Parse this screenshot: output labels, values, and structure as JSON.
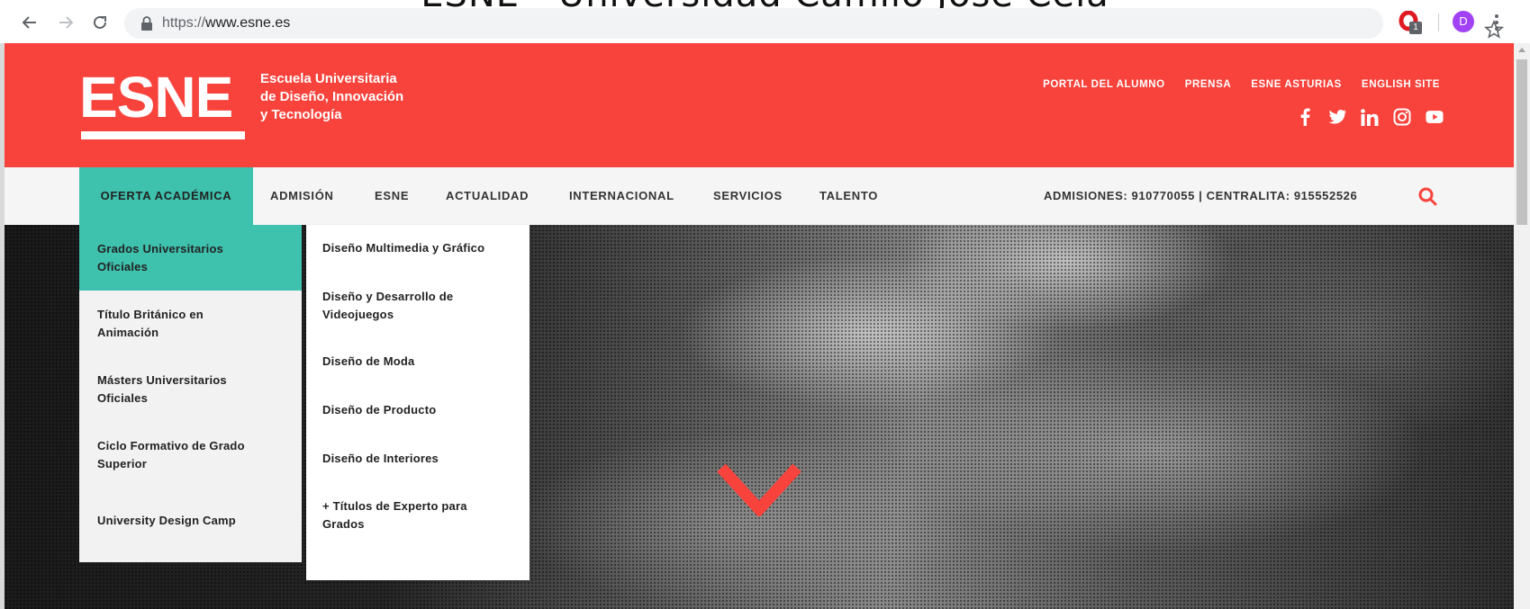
{
  "browser": {
    "window_title": "ESNE - Universidad Camilo José Cela",
    "url_scheme": "https://",
    "url_host": "www.esne.es",
    "extension_badge": "1",
    "profile_initial": "D"
  },
  "header": {
    "logo_text": "ESNE",
    "tagline": [
      "Escuela Universitaria",
      "de Diseño, Innovación",
      "y Tecnología"
    ],
    "top_links": [
      "PORTAL DEL ALUMNO",
      "PRENSA",
      "ESNE ASTURIAS",
      "ENGLISH SITE"
    ],
    "social": [
      "facebook-icon",
      "twitter-icon",
      "linkedin-icon",
      "instagram-icon",
      "youtube-icon"
    ]
  },
  "nav": {
    "items": [
      "OFERTA ACADÉMICA",
      "ADMISIÓN",
      "ESNE",
      "ACTUALIDAD",
      "INTERNACIONAL",
      "SERVICIOS",
      "TALENTO"
    ],
    "contact": "ADMISIONES: 910770055 | CENTRALITA: 915552526"
  },
  "mega_menu": {
    "categories": [
      [
        "Grados Universitarios",
        "Oficiales"
      ],
      [
        "Título Británico en",
        "Animación"
      ],
      [
        "Másters Universitarios",
        "Oficiales"
      ],
      [
        "Ciclo Formativo de Grado",
        "Superior"
      ],
      [
        "University Design Camp"
      ]
    ],
    "active_category": 0,
    "subitems": [
      [
        "Diseño Multimedia y Gráfico"
      ],
      [
        "Diseño y Desarrollo de",
        "Videojuegos"
      ],
      [
        "Diseño de Moda"
      ],
      [
        "Diseño de Producto"
      ],
      [
        "Diseño de Interiores"
      ],
      [
        "+ Títulos de Experto para",
        "Grados"
      ]
    ]
  },
  "colors": {
    "brand_red": "#f8433c",
    "menu_teal": "#3ec1ad",
    "nav_bg": "#f5f5f5"
  }
}
